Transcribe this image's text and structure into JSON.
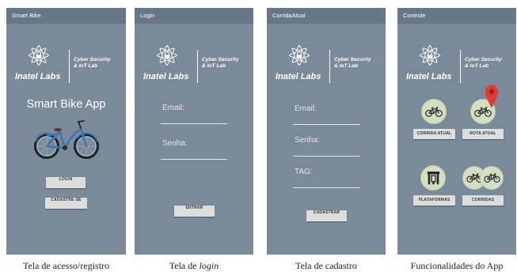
{
  "screen_access": {
    "title": "Smart Bike",
    "app_name": "Smart Bike App",
    "login_button": "LOGIN",
    "register_button": "CADASTRE-SE"
  },
  "screen_login": {
    "title": "Login",
    "email_hint": "Email:",
    "password_hint": "Senha:",
    "submit_button": "ENTRAR"
  },
  "screen_register": {
    "title": "CorridaAtual",
    "email_hint": "Email:",
    "password_hint": "Senha:",
    "tag_hint": "TAG:",
    "submit_button": "CADASTRAR"
  },
  "screen_control": {
    "title": "Controle",
    "current_ride_button": "CORRIDA ATUAL",
    "route_button": "ROTA ATUAL",
    "platforms_button": "PLATAFORMAS",
    "rides_button": "CORRIDAS"
  },
  "logo": {
    "brand": "Inatel Labs",
    "lab_line1": "Cyber Security",
    "lab_line2": "& IoT Lab"
  },
  "captions": {
    "access": "Tela de acesso/registro",
    "login_prefix": "Tela de ",
    "login_emphasis": "login",
    "register": "Tela de cadastro",
    "features": "Funcionalidades do App"
  },
  "icons": {
    "logo": "inatel-lotus-lock-icon",
    "hero": "bicycle-illustration",
    "current_ride": "bicycle-icon",
    "route": "map-pin-icon",
    "platforms": "bike-station-icon",
    "rides": "bicycles-icon"
  },
  "colors": {
    "panel_bg": "#7b8a99",
    "title_bar": "#677788",
    "button_bg": "#dcdddd",
    "icon_circle": "#d4dec1",
    "map_pin": "#e53935",
    "bike_frame": "#3f74b3"
  }
}
